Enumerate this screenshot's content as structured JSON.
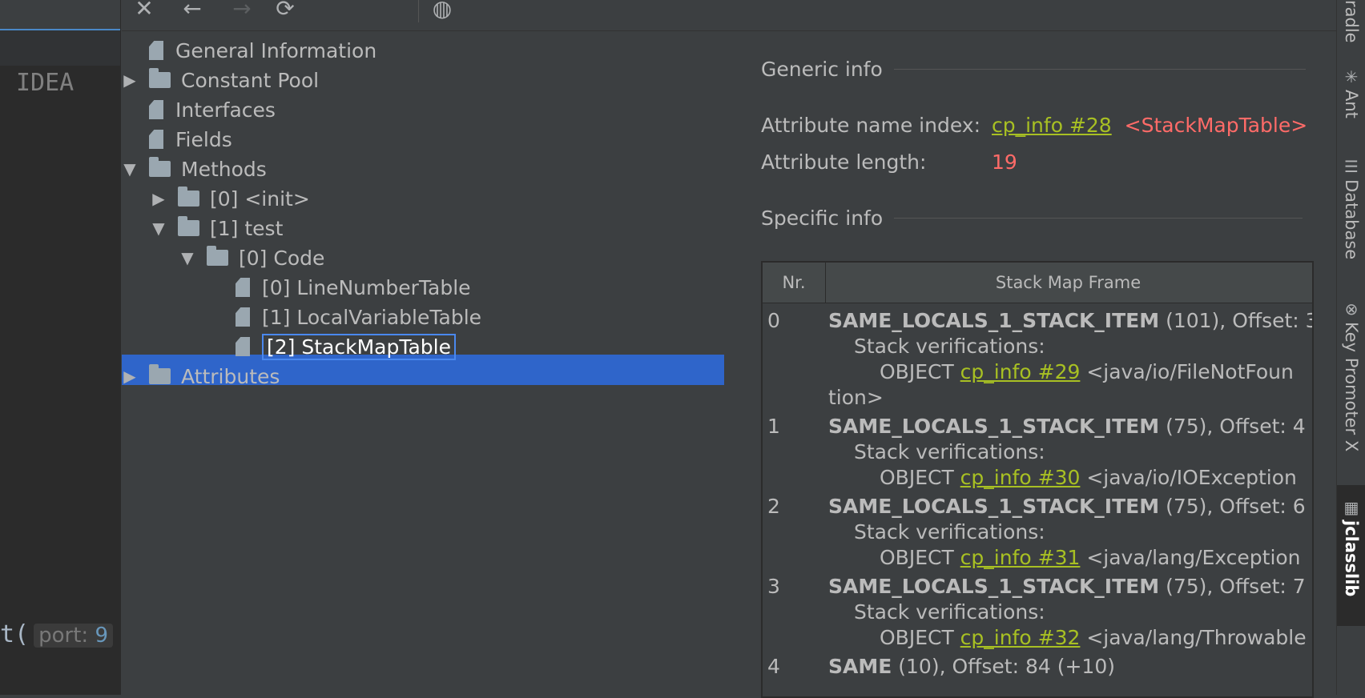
{
  "editor": {
    "idea_text": "IDEA",
    "code_prefix": "t(",
    "hint_label": "port:",
    "hint_value": "9"
  },
  "toolbar": {
    "close_icon": "✕",
    "back_icon": "←",
    "forward_icon": "→",
    "refresh_icon": "⟳",
    "browser_icon": "◍"
  },
  "tree": {
    "general": "General Information",
    "constant_pool": "Constant Pool",
    "interfaces": "Interfaces",
    "fields": "Fields",
    "methods": "Methods",
    "init": "[0] <init>",
    "test": "[1] test",
    "code": "[0] Code",
    "line_number_table": "[0] LineNumberTable",
    "local_variable_table": "[1] LocalVariableTable",
    "stack_map_table": "[2] StackMapTable",
    "attributes": "Attributes"
  },
  "details": {
    "generic_header": "Generic info",
    "attr_name_label": "Attribute name index:",
    "attr_name_link": "cp_info #28",
    "attr_name_value": "<StackMapTable>",
    "attr_length_label": "Attribute length:",
    "attr_length_value": "19",
    "specific_header": "Specific info"
  },
  "table": {
    "col_nr": "Nr.",
    "col_frame": "Stack Map Frame",
    "rows": [
      {
        "nr": "0",
        "frame_type": "SAME_LOCALS_1_STACK_ITEM",
        "frame_rest": " (101), Offset: 3",
        "verif": "Stack verifications:",
        "obj": "OBJECT ",
        "link": "cp_info #29",
        "target": " <java/io/FileNotFoun",
        "wrap": "tion>"
      },
      {
        "nr": "1",
        "frame_type": "SAME_LOCALS_1_STACK_ITEM",
        "frame_rest": " (75), Offset: 4",
        "verif": "Stack verifications:",
        "obj": "OBJECT ",
        "link": "cp_info #30",
        "target": " <java/io/IOException"
      },
      {
        "nr": "2",
        "frame_type": "SAME_LOCALS_1_STACK_ITEM",
        "frame_rest": " (75), Offset: 6",
        "verif": "Stack verifications:",
        "obj": "OBJECT ",
        "link": "cp_info #31",
        "target": " <java/lang/Exception"
      },
      {
        "nr": "3",
        "frame_type": "SAME_LOCALS_1_STACK_ITEM",
        "frame_rest": " (75), Offset: 7",
        "verif": "Stack verifications:",
        "obj": "OBJECT ",
        "link": "cp_info #32",
        "target": " <java/lang/Throwable"
      },
      {
        "nr": "4",
        "frame_type": "SAME",
        "frame_rest": " (10), Offset: 84 (+10)"
      }
    ]
  },
  "rightbar": {
    "gradle": "radle",
    "ant": "Ant",
    "database": "Database",
    "key_promoter": "Key Promoter X",
    "jclasslib": "jclasslib"
  },
  "colors": {
    "link": "#a8c023",
    "value_red": "#ff6b68",
    "selection": "#2f65ca"
  }
}
